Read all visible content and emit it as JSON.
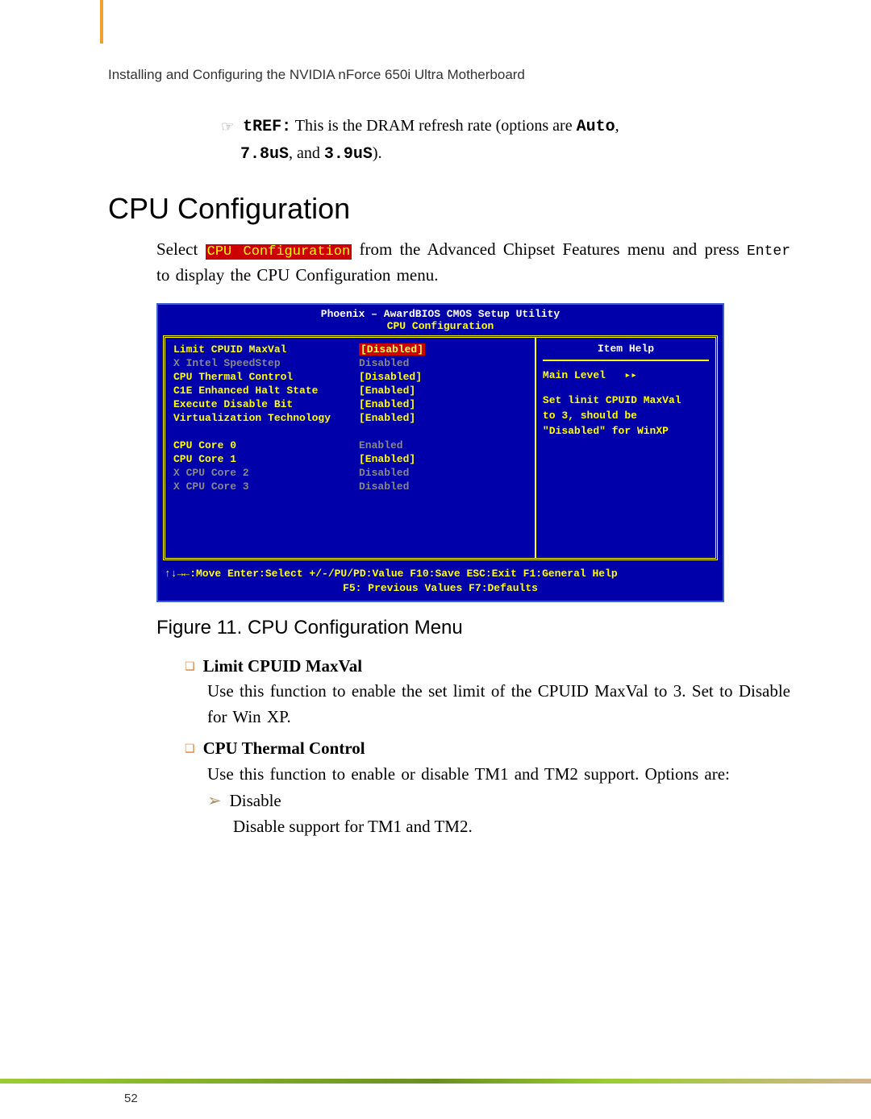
{
  "header": {
    "text": "Installing and Configuring the NVIDIA nForce 650i Ultra Motherboard"
  },
  "tref": {
    "label": "tREF:",
    "body1": " This is the DRAM refresh rate (options are ",
    "auto": "Auto",
    "body2": ", ",
    "v1": "7.8uS",
    "body3": ", and ",
    "v2": "3.9uS",
    "body4": ")."
  },
  "section_title": "CPU Configuration",
  "intro": {
    "p1a": "Select ",
    "hl": "CPU Configuration",
    "p1b": " from the Advanced Chipset Features menu and press ",
    "enter": "Enter",
    "p1c": " to display the CPU Configuration menu."
  },
  "bios": {
    "title": "Phoenix – AwardBIOS CMOS Setup Utility",
    "subtitle": "CPU Configuration",
    "rows": [
      {
        "prefix": "  ",
        "label": "Limit CPUID MaxVal",
        "value": "[Disabled]",
        "highlight": true,
        "gray": false
      },
      {
        "prefix": "X ",
        "label": "Intel SpeedStep",
        "value": "Disabled",
        "highlight": false,
        "gray": true
      },
      {
        "prefix": "  ",
        "label": "CPU Thermal Control",
        "value": "[Disabled]",
        "highlight": false,
        "gray": false
      },
      {
        "prefix": "  ",
        "label": "C1E Enhanced Halt State",
        "value": "[Enabled]",
        "highlight": false,
        "gray": false
      },
      {
        "prefix": "  ",
        "label": "Execute Disable Bit",
        "value": "[Enabled]",
        "highlight": false,
        "gray": false
      },
      {
        "prefix": "  ",
        "label": "Virtualization Technology",
        "value": "[Enabled]",
        "highlight": false,
        "gray": false
      },
      {
        "prefix": "  ",
        "label": "",
        "value": "",
        "highlight": false,
        "gray": false
      },
      {
        "prefix": "  ",
        "label": "CPU Core 0",
        "value": "Enabled",
        "highlight": false,
        "gray": true,
        "valgray": true
      },
      {
        "prefix": "  ",
        "label": "CPU Core 1",
        "value": "[Enabled]",
        "highlight": false,
        "gray": false
      },
      {
        "prefix": "X ",
        "label": "CPU Core 2",
        "value": "Disabled",
        "highlight": false,
        "gray": true
      },
      {
        "prefix": "X ",
        "label": "CPU Core 3",
        "value": "Disabled",
        "highlight": false,
        "gray": true
      }
    ],
    "help": {
      "title": "Item Help",
      "main_level": "Main Level",
      "arrows": "▸▸",
      "line1": "Set linit CPUID MaxVal",
      "line2": "to 3, should be",
      "line3": "\"Disabled\" for WinXP"
    },
    "footer": {
      "line1": "↑↓→←:Move  Enter:Select  +/-/PU/PD:Value  F10:Save  ESC:Exit  F1:General Help",
      "line2": "F5: Previous Values          F7:Defaults"
    }
  },
  "figure_caption": "Figure 11.    CPU Configuration Menu",
  "bullets": {
    "limit": {
      "head": "Limit CPUID MaxVal",
      "body": "Use this function to enable the set limit of the CPUID MaxVal to 3. Set to Disable for Win XP."
    },
    "thermal": {
      "head": "CPU Thermal Control",
      "body1": "Use this function to enable or disable TM1 and TM2 support. Options are:",
      "opt1": "Disable",
      "opt1_desc": "Disable support for TM1 and TM2."
    }
  },
  "footer_page": "52"
}
